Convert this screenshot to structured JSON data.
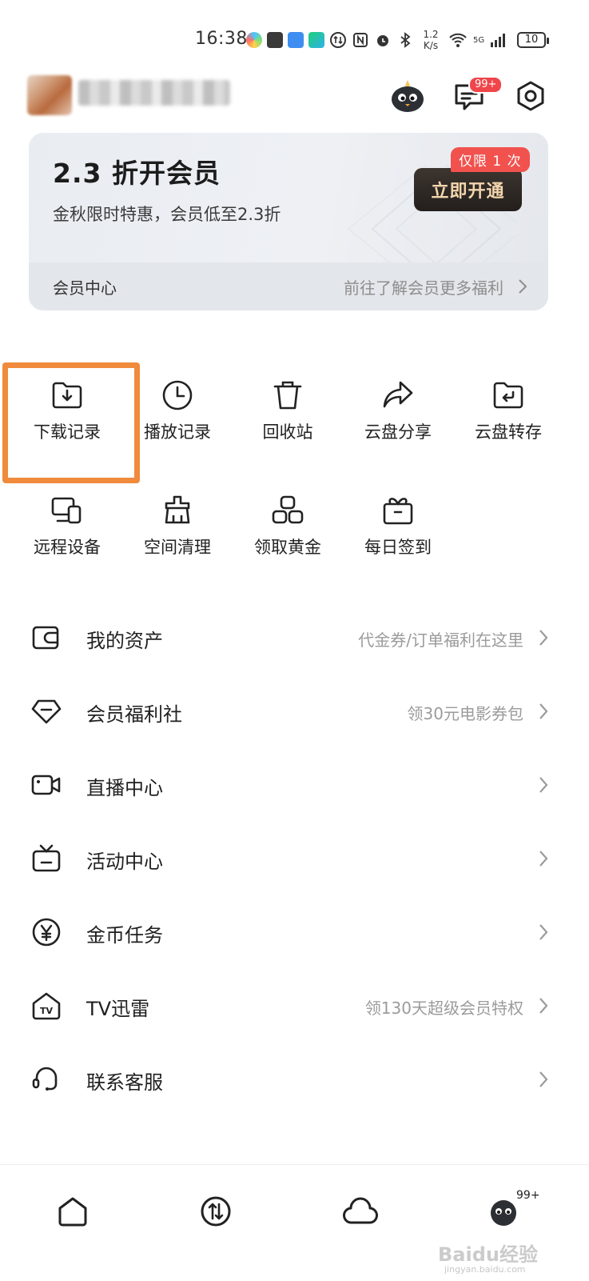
{
  "status_bar": {
    "time": "16:38",
    "net_speed_value": "1.2",
    "net_speed_unit": "K/s",
    "network": "5G",
    "battery": "10"
  },
  "header": {
    "message_badge": "99+"
  },
  "vip_card": {
    "title": "2.3 折开会员",
    "subtitle": "金秋限时特惠，会员低至2.3折",
    "tag": "仅限 1 次",
    "button": "立即开通",
    "center_label": "会员中心",
    "more_text": "前往了解会员更多福利"
  },
  "grid": [
    {
      "label": "下载记录",
      "icon": "download-folder-icon"
    },
    {
      "label": "播放记录",
      "icon": "clock-icon"
    },
    {
      "label": "回收站",
      "icon": "trash-icon"
    },
    {
      "label": "云盘分享",
      "icon": "share-icon"
    },
    {
      "label": "云盘转存",
      "icon": "folder-return-icon"
    },
    {
      "label": "远程设备",
      "icon": "devices-icon"
    },
    {
      "label": "空间清理",
      "icon": "broom-icon"
    },
    {
      "label": "领取黄金",
      "icon": "gold-bars-icon"
    },
    {
      "label": "每日签到",
      "icon": "gift-icon"
    }
  ],
  "menu": [
    {
      "label": "我的资产",
      "hint": "代金券/订单福利在这里",
      "icon": "wallet-icon"
    },
    {
      "label": "会员福利社",
      "hint": "领30元电影券包",
      "icon": "diamond-icon"
    },
    {
      "label": "直播中心",
      "hint": "",
      "icon": "video-camera-icon"
    },
    {
      "label": "活动中心",
      "hint": "",
      "icon": "tv-box-icon"
    },
    {
      "label": "金币任务",
      "hint": "",
      "icon": "yen-coin-icon"
    },
    {
      "label": "TV迅雷",
      "hint": "领130天超级会员特权",
      "icon": "tv-house-icon"
    },
    {
      "label": "联系客服",
      "hint": "",
      "icon": "headset-icon"
    }
  ],
  "tab_bar": {
    "profile_badge": "99+",
    "watermark": "Baidu经验",
    "watermark_sub": "jingyan.baidu.com"
  },
  "colors": {
    "highlight": "#f08a3c",
    "badge_red": "#f0454a",
    "vip_button_text": "#f3d6ad"
  }
}
